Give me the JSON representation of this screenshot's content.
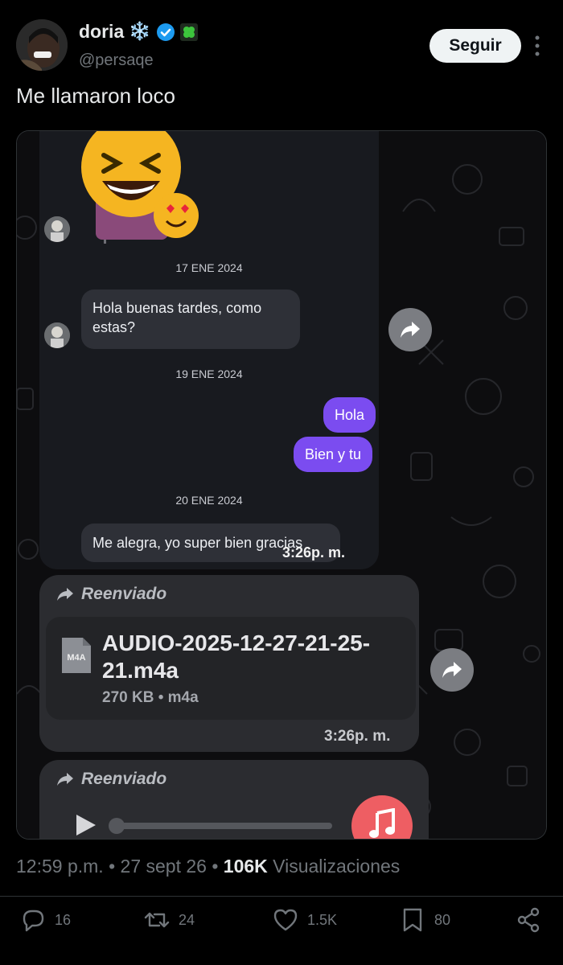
{
  "author": {
    "display_name": "doria",
    "name_emoji": "❄️",
    "verified_badge": "verified-badge-icon",
    "extra_badge": "clover-icon",
    "handle": "@persaqe"
  },
  "follow_label": "Seguir",
  "tweet_text": "Me llamaron loco",
  "media": {
    "chat": {
      "date1": "17 ENE 2024",
      "msg_in_1_line1": "Hola buenas tardes, como",
      "msg_in_1_line2": "estas?",
      "date2": "19 ENE 2024",
      "msg_out_1": "Hola",
      "msg_out_2": "Bien y tu",
      "date3": "20 ENE 2024",
      "msg_in_2": "Me alegra, yo super bien gracias",
      "time_overlay": "3:26p. m."
    },
    "file_card": {
      "forwarded_label": "Reenviado",
      "file_ext_badge": "M4A",
      "file_name_line1": "AUDIO-2025-12-27-21-25-",
      "file_name_line2": "21.m4a",
      "file_meta": "270 KB • m4a",
      "time": "3:26p. m."
    },
    "audio_card": {
      "forwarded_label": "Reenviado",
      "progress": 0
    },
    "colors": {
      "outgoing_bubble": "#7b4cf0",
      "incoming_bubble": "#2e3037",
      "music_icon_bg": "#ee5e63"
    }
  },
  "meta": {
    "time": "12:59 p.m.",
    "date": "27 sept 26",
    "views_count": "106K",
    "views_label": "Visualizaciones"
  },
  "actions": {
    "replies": "16",
    "reposts": "24",
    "likes": "1.5K",
    "bookmarks": "80"
  }
}
